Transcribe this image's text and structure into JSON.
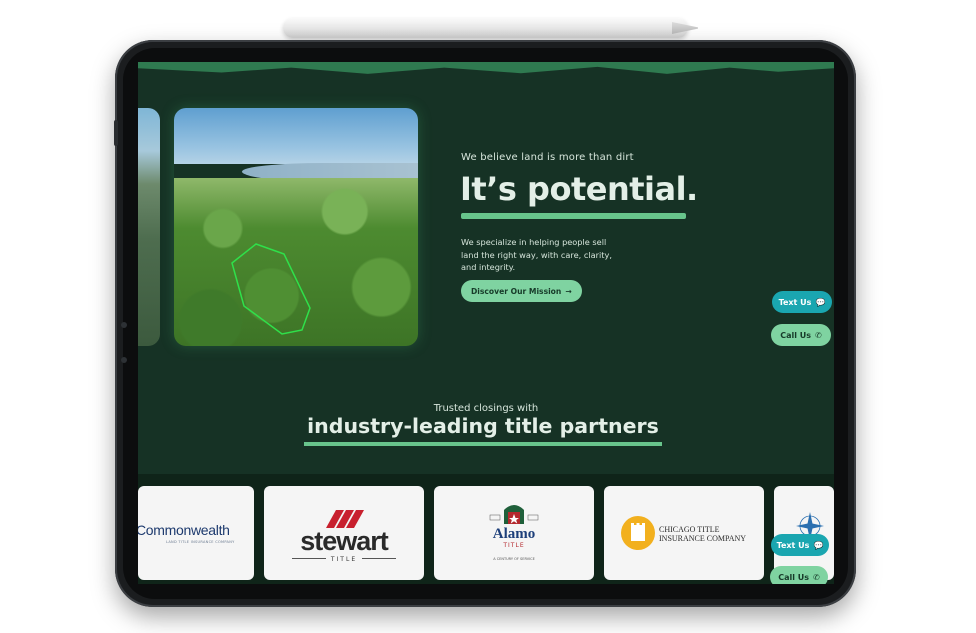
{
  "hero": {
    "tagline": "We believe land is more than dirt",
    "headline": "It’s potential.",
    "description": "We specialize in helping people sell land the right way, with care, clarity, and integrity.",
    "cta_label": "Discover Our Mission",
    "cta_icon": "arrow-right-icon"
  },
  "contact": {
    "text_label": "Text Us",
    "text_icon": "chat-icon",
    "call_label": "Call Us",
    "call_icon": "phone-icon"
  },
  "partners": {
    "pre_title": "Trusted closings with",
    "title": "industry-leading title partners",
    "logos": [
      {
        "name": "Commonwealth",
        "subtitle": "LAND TITLE INSURANCE COMPANY"
      },
      {
        "name": "stewart",
        "subtitle": "TITLE"
      },
      {
        "name": "Alamo",
        "subtitle": "TITLE",
        "tagline": "A CENTURY OF SERVICE"
      },
      {
        "name": "CHICAGO TITLE",
        "subtitle": "INSURANCE COMPANY"
      }
    ]
  },
  "colors": {
    "background": "#163225",
    "accent": "#68c58c",
    "button": "#7fd3a1",
    "text_us": "#1aa6b0"
  }
}
